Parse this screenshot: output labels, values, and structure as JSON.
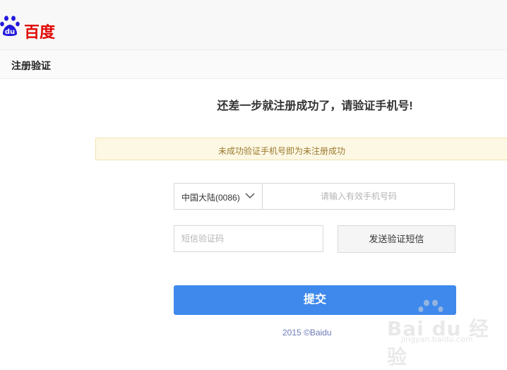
{
  "brand": {
    "logo_text": "百度",
    "logo_du": "du",
    "color": "#e10602"
  },
  "header": {
    "title": "注册验证"
  },
  "main": {
    "heading": "还差一步就注册成功了，请验证手机号!",
    "notice": "未成功验证手机号即为未注册成功",
    "country_select": "中国大陆(0086)",
    "phone_placeholder": "请输入有效手机号码",
    "code_placeholder": "短信验证码",
    "send_button": "发送验证短信",
    "submit_button": "提交"
  },
  "footer": {
    "copyright": "2015 ©Baidu"
  },
  "watermark": {
    "text": "Bai du 经验",
    "url": "jingyan.baidu.com"
  },
  "colors": {
    "accent": "#3f89ec",
    "notice_bg": "#fdf8e4",
    "notice_text": "#9a7a2e"
  }
}
